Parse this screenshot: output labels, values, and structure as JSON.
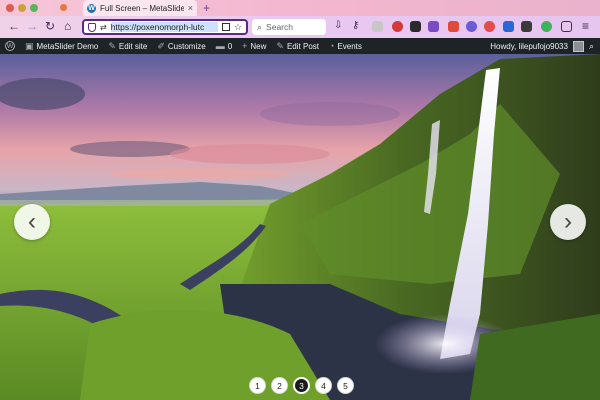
{
  "browser": {
    "tab_title": "Full Screen – MetaSlider Demo",
    "new_tab": "+",
    "url": "https://poxenomorph-lutc",
    "search_placeholder": "Search"
  },
  "adminbar": {
    "wp_logo": "W",
    "site_name": "MetaSlider Demo",
    "edit_site": "Edit site",
    "customize": "Customize",
    "comments_count": "0",
    "new_label": "New",
    "edit_post": "Edit Post",
    "events": "Events",
    "greeting": "Howdy, lilepufojo9033"
  },
  "slider": {
    "prev_arrow": "‹",
    "next_arrow": "›",
    "pages": [
      "1",
      "2",
      "3",
      "4",
      "5"
    ],
    "active_page": "3"
  },
  "colors": {
    "adminbar_bg": "#1d2327",
    "url_border": "#5b2a86",
    "tab_strip": "#f3b7cf"
  }
}
